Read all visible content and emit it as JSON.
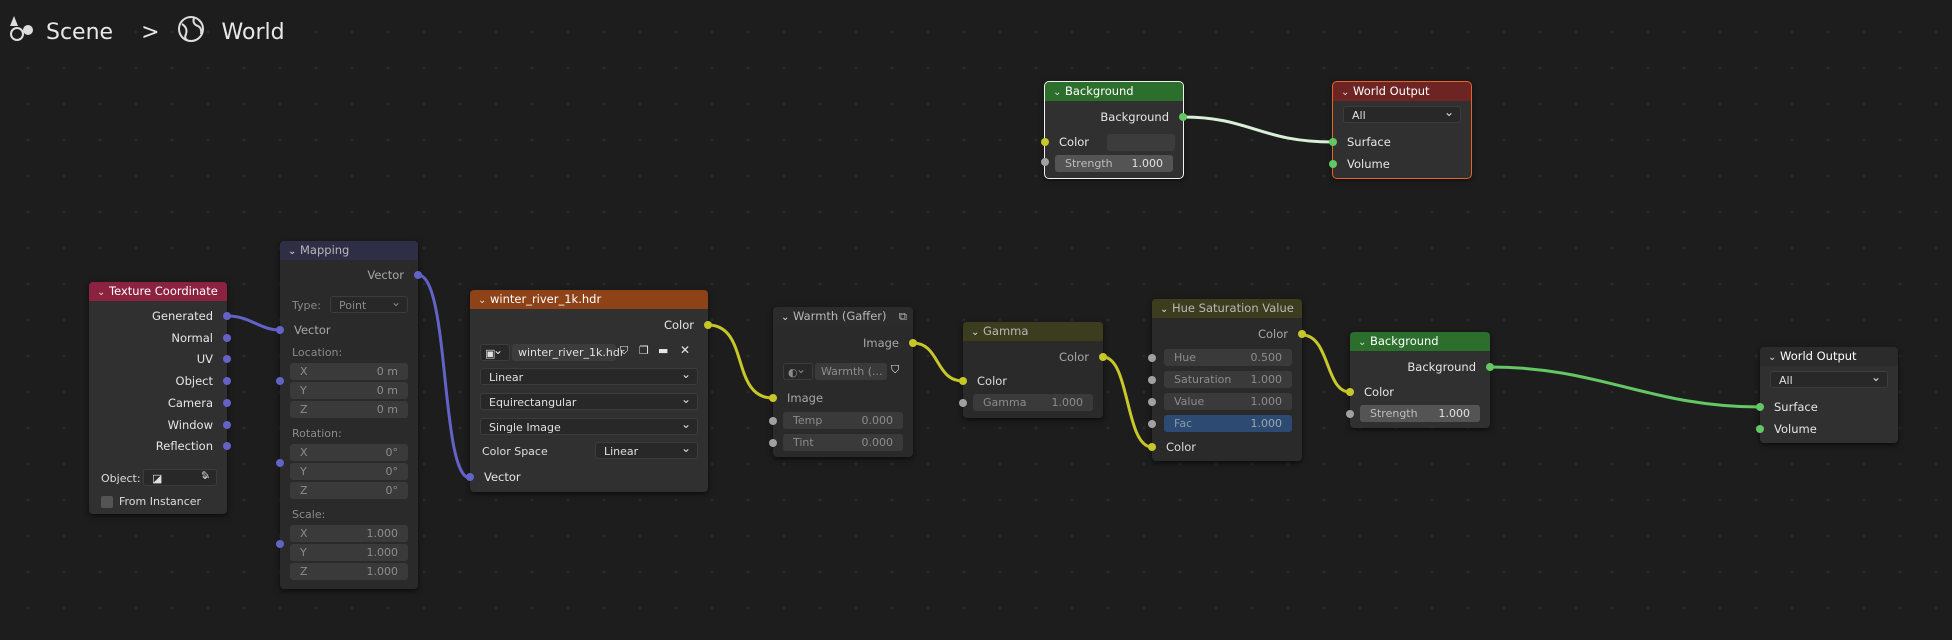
{
  "breadcrumb": {
    "scene": "Scene",
    "separator": ">",
    "world": "World",
    "scene_icon": "scene-icon",
    "world_icon": "world-icon"
  },
  "colors": {
    "shader_header": "#2c6e2c",
    "output_header": "#6e2423",
    "texture_header": "#8e4217",
    "input_header": "#8a2240",
    "vector_header": "#2e2e47",
    "color_header": "#3c3c1f",
    "wire_yellow": "#c7c729",
    "wire_purple": "#6363c7",
    "wire_green": "#63c763",
    "grid_bg": "#1d1d1d"
  },
  "nodes": {
    "bg_top": {
      "title": "Background",
      "out": "Background",
      "color": "Color",
      "strength_label": "Strength",
      "strength": "1.000"
    },
    "out_top": {
      "title": "World Output",
      "target": "All",
      "surface": "Surface",
      "volume": "Volume"
    },
    "texcoord": {
      "title": "Texture Coordinate",
      "outputs": [
        "Generated",
        "Normal",
        "UV",
        "Object",
        "Camera",
        "Window",
        "Reflection"
      ],
      "object_label": "Object:",
      "from_instancer": "From Instancer"
    },
    "mapping": {
      "title": "Mapping",
      "out": "Vector",
      "type_label": "Type:",
      "type_value": "Point",
      "in_vector": "Vector",
      "location": "Location:",
      "rotation": "Rotation:",
      "scale": "Scale:",
      "loc": [
        {
          "a": "X",
          "v": "0 m"
        },
        {
          "a": "Y",
          "v": "0 m"
        },
        {
          "a": "Z",
          "v": "0 m"
        }
      ],
      "rot": [
        {
          "a": "X",
          "v": "0°"
        },
        {
          "a": "Y",
          "v": "0°"
        },
        {
          "a": "Z",
          "v": "0°"
        }
      ],
      "scl": [
        {
          "a": "X",
          "v": "1.000"
        },
        {
          "a": "Y",
          "v": "1.000"
        },
        {
          "a": "Z",
          "v": "1.000"
        }
      ]
    },
    "env": {
      "title": "winter_river_1k.hdr",
      "out": "Color",
      "image": "winter_river_1k.hdr",
      "interp": "Linear",
      "proj": "Equirectangular",
      "source": "Single Image",
      "cs_label": "Color Space",
      "cs_value": "Linear",
      "in_vector": "Vector"
    },
    "warmth": {
      "title": "Warmth (Gaffer)",
      "out": "Image",
      "group": "Warmth (...",
      "in_image": "Image",
      "temp_label": "Temp",
      "temp": "0.000",
      "tint_label": "Tint",
      "tint": "0.000"
    },
    "gamma": {
      "title": "Gamma",
      "out": "Color",
      "in_color": "Color",
      "gamma_label": "Gamma",
      "gamma": "1.000"
    },
    "hsv": {
      "title": "Hue Saturation Value",
      "out": "Color",
      "hue_label": "Hue",
      "hue": "0.500",
      "sat_label": "Saturation",
      "sat": "1.000",
      "val_label": "Value",
      "val": "1.000",
      "fac_label": "Fac",
      "fac": "1.000",
      "in_color": "Color"
    },
    "bg_main": {
      "title": "Background",
      "out": "Background",
      "color": "Color",
      "strength_label": "Strength",
      "strength": "1.000"
    },
    "out_main": {
      "title": "World Output",
      "target": "All",
      "surface": "Surface",
      "volume": "Volume"
    }
  }
}
